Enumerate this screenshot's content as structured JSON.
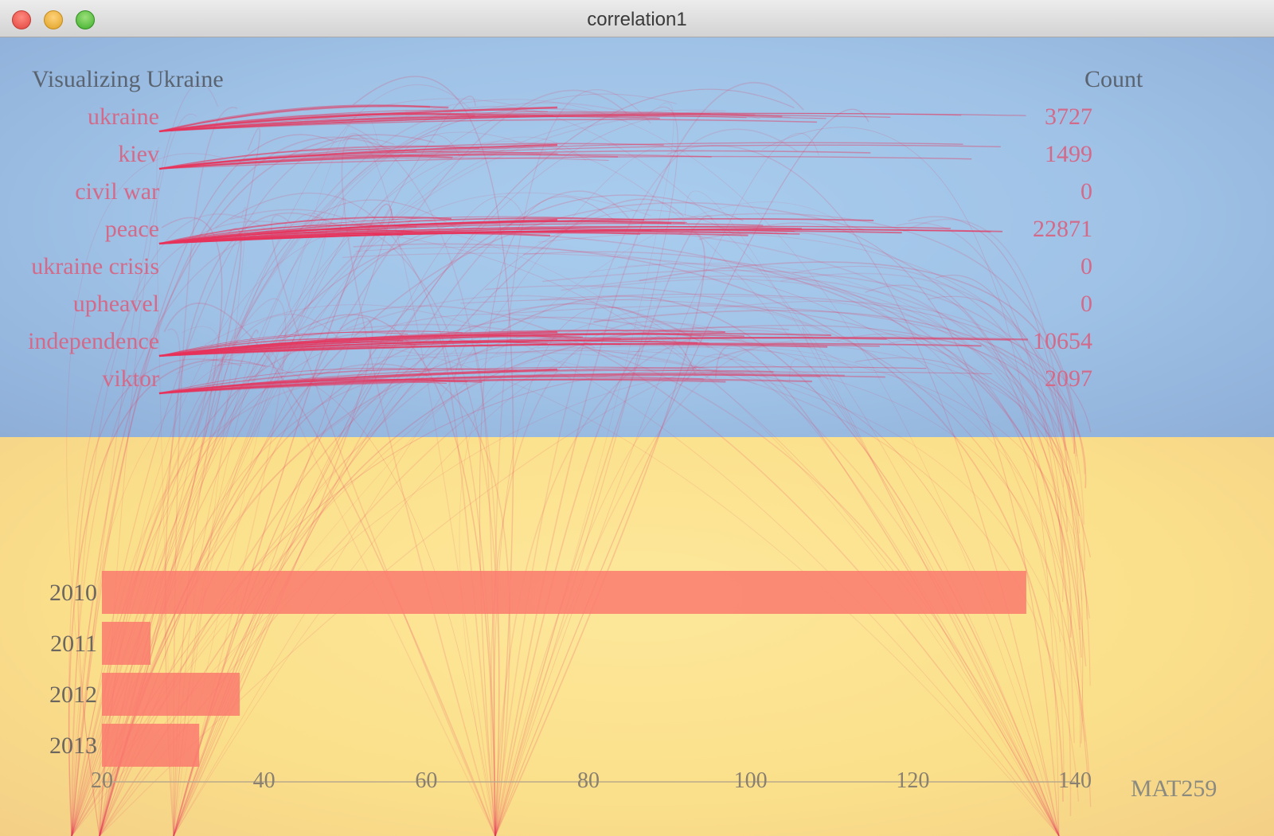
{
  "window": {
    "title": "correlation1"
  },
  "header": {
    "title": "Visualizing Ukraine",
    "count_label": "Count"
  },
  "keywords": [
    {
      "label": "ukraine",
      "count": "3727"
    },
    {
      "label": "kiev",
      "count": "1499"
    },
    {
      "label": "civil war",
      "count": "0"
    },
    {
      "label": "peace",
      "count": "22871"
    },
    {
      "label": "ukraine crisis",
      "count": "0"
    },
    {
      "label": "upheavel",
      "count": "0"
    },
    {
      "label": "independence",
      "count": "10654"
    },
    {
      "label": "viktor",
      "count": "2097"
    }
  ],
  "footer": {
    "label": "MAT259"
  },
  "colors": {
    "flag_blue": "#a9cdee",
    "flag_yellow": "#fce79a",
    "link_red": "#e8325a",
    "bar_fill": "#fa7a6e",
    "label_pink": "#d46a8a"
  },
  "chart_data": {
    "type": "bar",
    "orientation": "horizontal",
    "categories": [
      "2010",
      "2011",
      "2012",
      "2013"
    ],
    "values": [
      134,
      26,
      37,
      32
    ],
    "xlim": [
      20,
      140
    ],
    "xticks": [
      "20",
      "40",
      "60",
      "80",
      "100",
      "120",
      "140"
    ],
    "grid": false
  }
}
